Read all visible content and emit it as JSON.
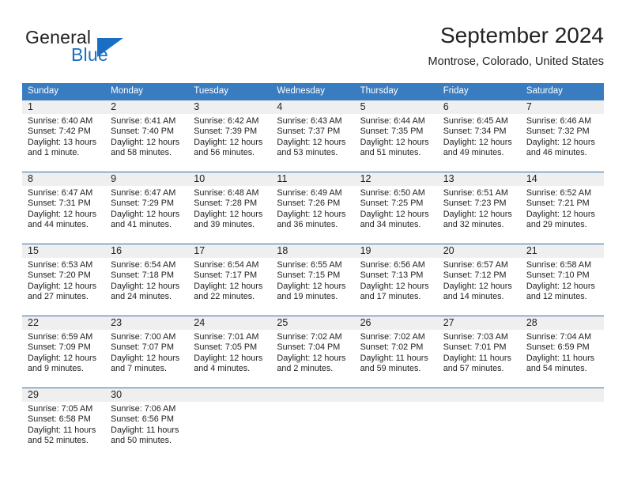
{
  "brand": {
    "word_one": "General",
    "word_two": "Blue",
    "triangle_icon": "blue-triangle-icon",
    "accent_color": "#1a6fc4"
  },
  "header": {
    "title": "September 2024",
    "subtitle": "Montrose, Colorado, United States"
  },
  "theme": {
    "header_bar_color": "#3a7cc0",
    "day_band_color": "#efefef",
    "rule_color": "#2e6da8",
    "text_color": "#222222"
  },
  "calendar": {
    "weekday_headers": [
      "Sunday",
      "Monday",
      "Tuesday",
      "Wednesday",
      "Thursday",
      "Friday",
      "Saturday"
    ],
    "weeks": [
      [
        {
          "day": "1",
          "sunrise": "Sunrise: 6:40 AM",
          "sunset": "Sunset: 7:42 PM",
          "daylight_line1": "Daylight: 13 hours",
          "daylight_line2": "and 1 minute."
        },
        {
          "day": "2",
          "sunrise": "Sunrise: 6:41 AM",
          "sunset": "Sunset: 7:40 PM",
          "daylight_line1": "Daylight: 12 hours",
          "daylight_line2": "and 58 minutes."
        },
        {
          "day": "3",
          "sunrise": "Sunrise: 6:42 AM",
          "sunset": "Sunset: 7:39 PM",
          "daylight_line1": "Daylight: 12 hours",
          "daylight_line2": "and 56 minutes."
        },
        {
          "day": "4",
          "sunrise": "Sunrise: 6:43 AM",
          "sunset": "Sunset: 7:37 PM",
          "daylight_line1": "Daylight: 12 hours",
          "daylight_line2": "and 53 minutes."
        },
        {
          "day": "5",
          "sunrise": "Sunrise: 6:44 AM",
          "sunset": "Sunset: 7:35 PM",
          "daylight_line1": "Daylight: 12 hours",
          "daylight_line2": "and 51 minutes."
        },
        {
          "day": "6",
          "sunrise": "Sunrise: 6:45 AM",
          "sunset": "Sunset: 7:34 PM",
          "daylight_line1": "Daylight: 12 hours",
          "daylight_line2": "and 49 minutes."
        },
        {
          "day": "7",
          "sunrise": "Sunrise: 6:46 AM",
          "sunset": "Sunset: 7:32 PM",
          "daylight_line1": "Daylight: 12 hours",
          "daylight_line2": "and 46 minutes."
        }
      ],
      [
        {
          "day": "8",
          "sunrise": "Sunrise: 6:47 AM",
          "sunset": "Sunset: 7:31 PM",
          "daylight_line1": "Daylight: 12 hours",
          "daylight_line2": "and 44 minutes."
        },
        {
          "day": "9",
          "sunrise": "Sunrise: 6:47 AM",
          "sunset": "Sunset: 7:29 PM",
          "daylight_line1": "Daylight: 12 hours",
          "daylight_line2": "and 41 minutes."
        },
        {
          "day": "10",
          "sunrise": "Sunrise: 6:48 AM",
          "sunset": "Sunset: 7:28 PM",
          "daylight_line1": "Daylight: 12 hours",
          "daylight_line2": "and 39 minutes."
        },
        {
          "day": "11",
          "sunrise": "Sunrise: 6:49 AM",
          "sunset": "Sunset: 7:26 PM",
          "daylight_line1": "Daylight: 12 hours",
          "daylight_line2": "and 36 minutes."
        },
        {
          "day": "12",
          "sunrise": "Sunrise: 6:50 AM",
          "sunset": "Sunset: 7:25 PM",
          "daylight_line1": "Daylight: 12 hours",
          "daylight_line2": "and 34 minutes."
        },
        {
          "day": "13",
          "sunrise": "Sunrise: 6:51 AM",
          "sunset": "Sunset: 7:23 PM",
          "daylight_line1": "Daylight: 12 hours",
          "daylight_line2": "and 32 minutes."
        },
        {
          "day": "14",
          "sunrise": "Sunrise: 6:52 AM",
          "sunset": "Sunset: 7:21 PM",
          "daylight_line1": "Daylight: 12 hours",
          "daylight_line2": "and 29 minutes."
        }
      ],
      [
        {
          "day": "15",
          "sunrise": "Sunrise: 6:53 AM",
          "sunset": "Sunset: 7:20 PM",
          "daylight_line1": "Daylight: 12 hours",
          "daylight_line2": "and 27 minutes."
        },
        {
          "day": "16",
          "sunrise": "Sunrise: 6:54 AM",
          "sunset": "Sunset: 7:18 PM",
          "daylight_line1": "Daylight: 12 hours",
          "daylight_line2": "and 24 minutes."
        },
        {
          "day": "17",
          "sunrise": "Sunrise: 6:54 AM",
          "sunset": "Sunset: 7:17 PM",
          "daylight_line1": "Daylight: 12 hours",
          "daylight_line2": "and 22 minutes."
        },
        {
          "day": "18",
          "sunrise": "Sunrise: 6:55 AM",
          "sunset": "Sunset: 7:15 PM",
          "daylight_line1": "Daylight: 12 hours",
          "daylight_line2": "and 19 minutes."
        },
        {
          "day": "19",
          "sunrise": "Sunrise: 6:56 AM",
          "sunset": "Sunset: 7:13 PM",
          "daylight_line1": "Daylight: 12 hours",
          "daylight_line2": "and 17 minutes."
        },
        {
          "day": "20",
          "sunrise": "Sunrise: 6:57 AM",
          "sunset": "Sunset: 7:12 PM",
          "daylight_line1": "Daylight: 12 hours",
          "daylight_line2": "and 14 minutes."
        },
        {
          "day": "21",
          "sunrise": "Sunrise: 6:58 AM",
          "sunset": "Sunset: 7:10 PM",
          "daylight_line1": "Daylight: 12 hours",
          "daylight_line2": "and 12 minutes."
        }
      ],
      [
        {
          "day": "22",
          "sunrise": "Sunrise: 6:59 AM",
          "sunset": "Sunset: 7:09 PM",
          "daylight_line1": "Daylight: 12 hours",
          "daylight_line2": "and 9 minutes."
        },
        {
          "day": "23",
          "sunrise": "Sunrise: 7:00 AM",
          "sunset": "Sunset: 7:07 PM",
          "daylight_line1": "Daylight: 12 hours",
          "daylight_line2": "and 7 minutes."
        },
        {
          "day": "24",
          "sunrise": "Sunrise: 7:01 AM",
          "sunset": "Sunset: 7:05 PM",
          "daylight_line1": "Daylight: 12 hours",
          "daylight_line2": "and 4 minutes."
        },
        {
          "day": "25",
          "sunrise": "Sunrise: 7:02 AM",
          "sunset": "Sunset: 7:04 PM",
          "daylight_line1": "Daylight: 12 hours",
          "daylight_line2": "and 2 minutes."
        },
        {
          "day": "26",
          "sunrise": "Sunrise: 7:02 AM",
          "sunset": "Sunset: 7:02 PM",
          "daylight_line1": "Daylight: 11 hours",
          "daylight_line2": "and 59 minutes."
        },
        {
          "day": "27",
          "sunrise": "Sunrise: 7:03 AM",
          "sunset": "Sunset: 7:01 PM",
          "daylight_line1": "Daylight: 11 hours",
          "daylight_line2": "and 57 minutes."
        },
        {
          "day": "28",
          "sunrise": "Sunrise: 7:04 AM",
          "sunset": "Sunset: 6:59 PM",
          "daylight_line1": "Daylight: 11 hours",
          "daylight_line2": "and 54 minutes."
        }
      ],
      [
        {
          "day": "29",
          "sunrise": "Sunrise: 7:05 AM",
          "sunset": "Sunset: 6:58 PM",
          "daylight_line1": "Daylight: 11 hours",
          "daylight_line2": "and 52 minutes."
        },
        {
          "day": "30",
          "sunrise": "Sunrise: 7:06 AM",
          "sunset": "Sunset: 6:56 PM",
          "daylight_line1": "Daylight: 11 hours",
          "daylight_line2": "and 50 minutes."
        },
        {
          "day": "",
          "sunrise": "",
          "sunset": "",
          "daylight_line1": "",
          "daylight_line2": ""
        },
        {
          "day": "",
          "sunrise": "",
          "sunset": "",
          "daylight_line1": "",
          "daylight_line2": ""
        },
        {
          "day": "",
          "sunrise": "",
          "sunset": "",
          "daylight_line1": "",
          "daylight_line2": ""
        },
        {
          "day": "",
          "sunrise": "",
          "sunset": "",
          "daylight_line1": "",
          "daylight_line2": ""
        },
        {
          "day": "",
          "sunrise": "",
          "sunset": "",
          "daylight_line1": "",
          "daylight_line2": ""
        }
      ]
    ]
  }
}
